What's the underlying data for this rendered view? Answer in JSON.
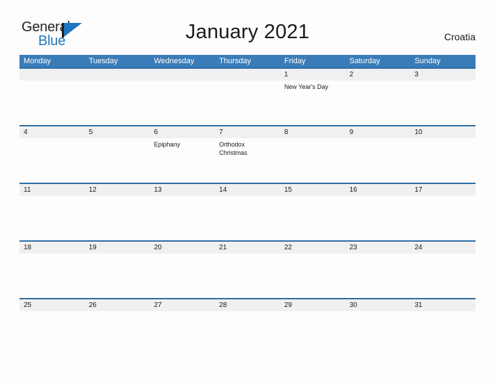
{
  "header": {
    "logo": {
      "word_one": "General",
      "word_two": "Blue",
      "icon": "triangle-flag-icon",
      "color_dark": "#231f20",
      "color_blue": "#1f77bd"
    },
    "title": "January 2021",
    "country": "Croatia"
  },
  "theme": {
    "header_blue": "#3a7cb8",
    "rule_blue": "#2e6da4",
    "date_band_gray": "#f0f0f0",
    "page_background": "#fdfdfd",
    "text": "#1a1a1a"
  },
  "calendar": {
    "weekdays": [
      "Monday",
      "Tuesday",
      "Wednesday",
      "Thursday",
      "Friday",
      "Saturday",
      "Sunday"
    ],
    "weeks": [
      {
        "days": [
          {
            "date": "",
            "events": []
          },
          {
            "date": "",
            "events": []
          },
          {
            "date": "",
            "events": []
          },
          {
            "date": "",
            "events": []
          },
          {
            "date": "1",
            "events": [
              "New Year's Day"
            ]
          },
          {
            "date": "2",
            "events": []
          },
          {
            "date": "3",
            "events": []
          }
        ]
      },
      {
        "days": [
          {
            "date": "4",
            "events": []
          },
          {
            "date": "5",
            "events": []
          },
          {
            "date": "6",
            "events": [
              "Epiphany"
            ]
          },
          {
            "date": "7",
            "events": [
              "Orthodox Christmas"
            ]
          },
          {
            "date": "8",
            "events": []
          },
          {
            "date": "9",
            "events": []
          },
          {
            "date": "10",
            "events": []
          }
        ]
      },
      {
        "days": [
          {
            "date": "11",
            "events": []
          },
          {
            "date": "12",
            "events": []
          },
          {
            "date": "13",
            "events": []
          },
          {
            "date": "14",
            "events": []
          },
          {
            "date": "15",
            "events": []
          },
          {
            "date": "16",
            "events": []
          },
          {
            "date": "17",
            "events": []
          }
        ]
      },
      {
        "days": [
          {
            "date": "18",
            "events": []
          },
          {
            "date": "19",
            "events": []
          },
          {
            "date": "20",
            "events": []
          },
          {
            "date": "21",
            "events": []
          },
          {
            "date": "22",
            "events": []
          },
          {
            "date": "23",
            "events": []
          },
          {
            "date": "24",
            "events": []
          }
        ]
      },
      {
        "days": [
          {
            "date": "25",
            "events": []
          },
          {
            "date": "26",
            "events": []
          },
          {
            "date": "27",
            "events": []
          },
          {
            "date": "28",
            "events": []
          },
          {
            "date": "29",
            "events": []
          },
          {
            "date": "30",
            "events": []
          },
          {
            "date": "31",
            "events": []
          }
        ]
      }
    ]
  }
}
